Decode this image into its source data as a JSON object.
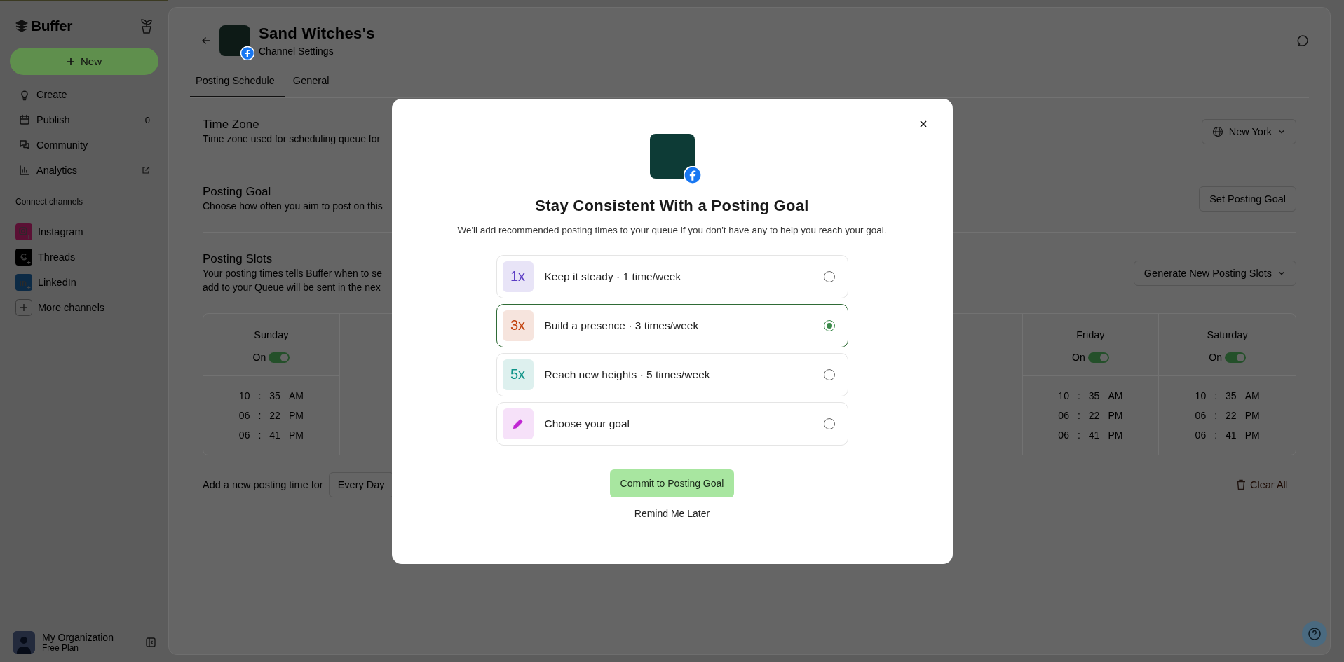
{
  "sidebar": {
    "brand": "Buffer",
    "new_button": "New",
    "nav": [
      {
        "label": "Create"
      },
      {
        "label": "Publish",
        "count": "0"
      },
      {
        "label": "Community"
      },
      {
        "label": "Analytics"
      }
    ],
    "section_label": "Connect channels",
    "channels": [
      {
        "label": "Instagram",
        "kind": "instagram"
      },
      {
        "label": "Threads",
        "kind": "threads"
      },
      {
        "label": "LinkedIn",
        "kind": "linkedin"
      },
      {
        "label": "More channels",
        "kind": "more"
      }
    ],
    "account": {
      "name": "My Organization",
      "plan": "Free Plan"
    }
  },
  "header": {
    "title": "Sand Witches's",
    "subtitle": "Channel Settings"
  },
  "tabs": [
    {
      "label": "Posting Schedule",
      "selected": true
    },
    {
      "label": "General",
      "selected": false
    }
  ],
  "sections": [
    {
      "title": "Time Zone",
      "description": [
        "Time zone used for scheduling queue for"
      ],
      "action": {
        "kind": "select",
        "label": "New York"
      }
    },
    {
      "title": "Posting Goal",
      "description": [
        "Choose how often you aim to post on this"
      ],
      "action": {
        "kind": "button",
        "label": "Set Posting Goal"
      }
    },
    {
      "title": "Posting Slots",
      "description": [
        "Your posting times tells Buffer when to se",
        "add to your Queue will be sent in the nex"
      ],
      "action": {
        "kind": "dropdown",
        "label": "Generate New Posting Slots"
      }
    }
  ],
  "schedule": {
    "days": [
      {
        "name": "Sunday",
        "toggle_label": "On",
        "on": true,
        "times": [
          [
            "10",
            ":",
            "35",
            "AM"
          ],
          [
            "06",
            ":",
            "22",
            "PM"
          ],
          [
            "06",
            ":",
            "41",
            "PM"
          ]
        ]
      },
      {
        "name": "Friday",
        "toggle_label": "On",
        "on": true,
        "times": [
          [
            "10",
            ":",
            "35",
            "AM"
          ],
          [
            "06",
            ":",
            "22",
            "PM"
          ],
          [
            "06",
            ":",
            "41",
            "PM"
          ]
        ]
      },
      {
        "name": "Saturday",
        "toggle_label": "On",
        "on": true,
        "times": [
          [
            "10",
            ":",
            "35",
            "AM"
          ],
          [
            "06",
            ":",
            "22",
            "PM"
          ],
          [
            "06",
            ":",
            "41",
            "PM"
          ]
        ]
      }
    ]
  },
  "add_time": {
    "label": "Add a new posting time for",
    "select": "Every Day"
  },
  "clear_all": "Clear All",
  "modal": {
    "title": "Stay Consistent With a Posting Goal",
    "subtitle": "We'll add recommended posting times to your queue if you don't have any to help you reach your goal.",
    "options": [
      {
        "kind": "text",
        "badge": "1x",
        "label": "Keep it steady · 1 time/week",
        "selected": false,
        "color": "#5b3cc4"
      },
      {
        "kind": "text",
        "badge": "3x",
        "label": "Build a presence · 3 times/week",
        "selected": true,
        "color": "#c2410c"
      },
      {
        "kind": "text",
        "badge": "5x",
        "label": "Reach new heights · 5 times/week",
        "selected": false,
        "color": "#0f9488"
      },
      {
        "kind": "icon",
        "label": "Choose your goal",
        "selected": false,
        "color": "#c026d3"
      }
    ],
    "primary_button": "Commit to Posting Goal",
    "secondary_button": "Remind Me Later"
  }
}
